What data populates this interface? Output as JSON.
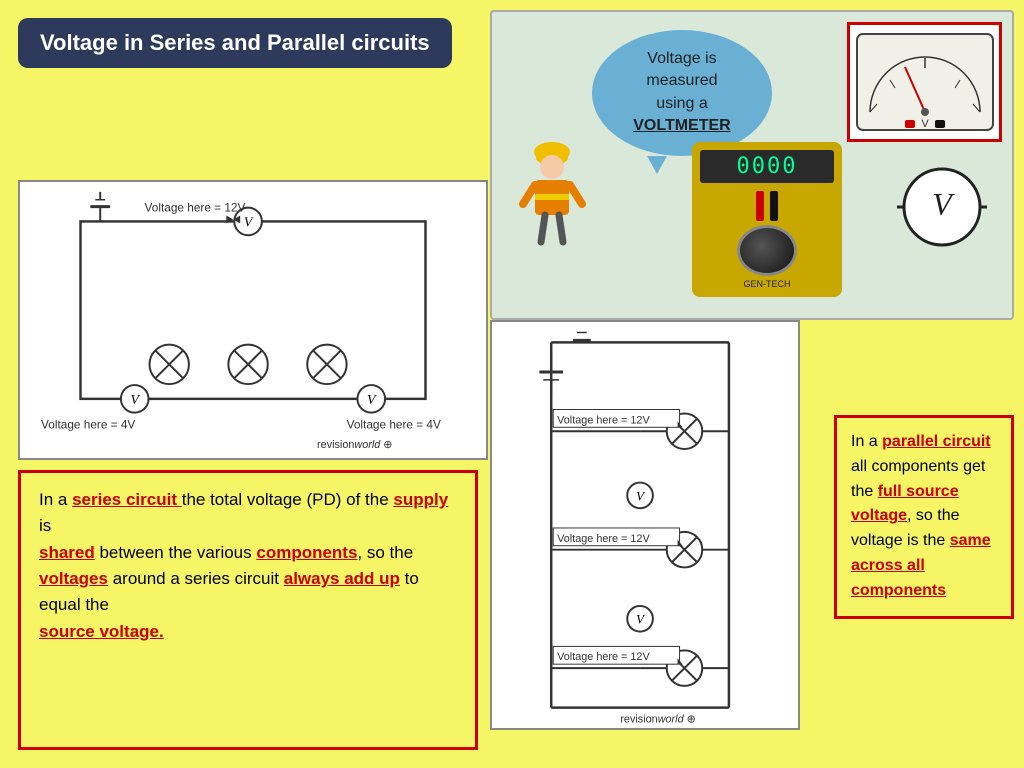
{
  "title": "Voltage in Series and Parallel circuits",
  "speech_bubble": {
    "line1": "Voltage is",
    "line2": "measured",
    "line3": "using a",
    "line4": "VOLTMETER"
  },
  "digital_display": "0000",
  "series_labels": {
    "top": "Voltage here = 12V",
    "bottom_left": "Voltage here = 4V",
    "bottom_right": "Voltage here = 4V"
  },
  "parallel_labels": {
    "top": "Voltage here = 12V",
    "middle": "Voltage here = 12V",
    "bottom": "Voltage here = 12V"
  },
  "series_text": {
    "part1": "In a ",
    "part2": "series circuit ",
    "part3": "the total voltage (PD) of the ",
    "part4": "supply",
    "part5": " is ",
    "part6": "shared",
    "part7": " between the various ",
    "part8": "components",
    "part9": ", so the ",
    "part10": "voltages",
    "part11": " around a series circuit ",
    "part12": "always add up",
    "part13": " to equal the ",
    "part14": "source voltage."
  },
  "parallel_text": {
    "part1": "In a ",
    "part2": "parallel circuit ",
    "part3": "all components get the ",
    "part4": "full source voltage",
    "part5": ", so the voltage is the ",
    "part6": "same across all components"
  },
  "revision_world": "revisionworld"
}
